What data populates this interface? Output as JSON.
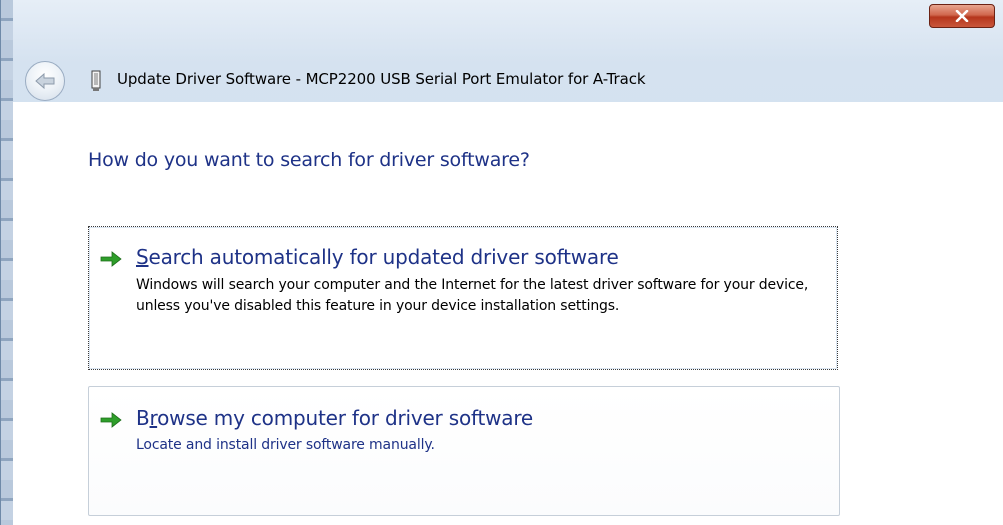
{
  "window": {
    "title": "Update Driver Software - MCP2200 USB Serial Port Emulator for A-Track",
    "close_icon": "close-icon",
    "back_icon": "back-arrow-icon",
    "device_icon": "usb-device-icon"
  },
  "main": {
    "heading": "How do you want to search for driver software?",
    "options": [
      {
        "title_first": "S",
        "title_rest": "earch automatically for updated driver software",
        "description": "Windows will search your computer and the Internet for the latest driver software for your device, unless you've disabled this feature in your device installation settings.",
        "icon": "green-arrow-icon"
      },
      {
        "title_first": "B",
        "title_u": "r",
        "title_rest": "owse my computer for driver software",
        "description": "Locate and install driver software manually.",
        "icon": "green-arrow-icon"
      }
    ]
  },
  "colors": {
    "heading": "#1e3287",
    "link": "#1e3287",
    "arrow": "#2e9e2a",
    "close": "#c44a30"
  }
}
